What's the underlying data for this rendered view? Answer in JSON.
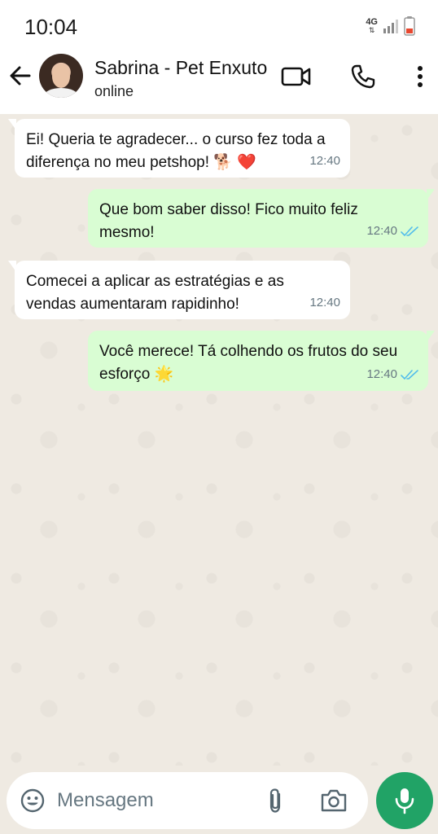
{
  "status_bar": {
    "time": "10:04",
    "network": "4G",
    "icons": [
      "signal-icon",
      "battery-icon"
    ]
  },
  "header": {
    "contact_name": "Sabrina - Pet Enxuto",
    "contact_status": "online",
    "icons": [
      "back-arrow-icon",
      "video-call-icon",
      "phone-icon",
      "more-vert-icon"
    ]
  },
  "messages": [
    {
      "direction": "in",
      "text": "Ei! Queria te agradecer... o curso fez toda a diferença no meu petshop! 🐕 ❤️",
      "time": "12:40"
    },
    {
      "direction": "out",
      "text": "Que bom saber disso! Fico muito feliz mesmo!",
      "time": "12:40",
      "status": "read"
    },
    {
      "direction": "in",
      "text": "Comecei a aplicar as estratégias e as vendas aumentaram rapidinho!",
      "time": "12:40"
    },
    {
      "direction": "out",
      "text": "Você merece! Tá colhendo os frutos do seu esforço 🌟",
      "time": "12:40",
      "status": "read"
    }
  ],
  "input": {
    "placeholder": "Mensagem",
    "icons": [
      "emoji-icon",
      "attach-icon",
      "camera-icon",
      "mic-icon"
    ]
  },
  "colors": {
    "outgoing_bubble": "#d9fdd3",
    "incoming_bubble": "#ffffff",
    "chat_background": "#efeae2",
    "accent": "#21a366",
    "read_ticks": "#53bdeb"
  }
}
